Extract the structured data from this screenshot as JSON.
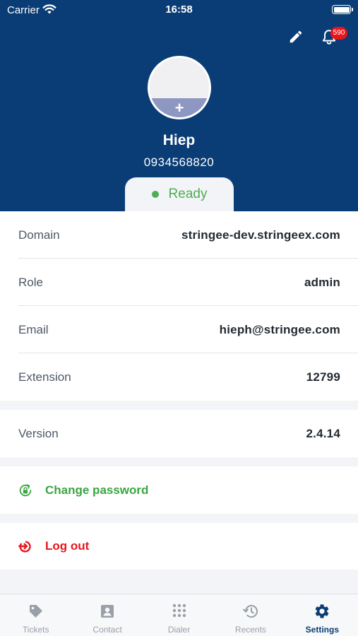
{
  "status_bar": {
    "carrier": "Carrier",
    "time": "16:58"
  },
  "header": {
    "notification_count": "590",
    "name": "Hiep",
    "phone": "0934568820",
    "status": "Ready",
    "status_color": "#4caf50",
    "header_color": "#0a3d75"
  },
  "info": {
    "domain": {
      "label": "Domain",
      "value": "stringee-dev.stringeex.com"
    },
    "role": {
      "label": "Role",
      "value": "admin"
    },
    "email": {
      "label": "Email",
      "value": "hieph@stringee.com"
    },
    "extension": {
      "label": "Extension",
      "value": "12799"
    },
    "version": {
      "label": "Version",
      "value": "2.4.14"
    }
  },
  "actions": {
    "change_password": {
      "label": "Change password",
      "icon": "lock-refresh-icon",
      "color": "#3aa642"
    },
    "logout": {
      "label": "Log out",
      "icon": "logout-icon",
      "color": "#e8151b"
    }
  },
  "tabs": [
    {
      "label": "Tickets",
      "icon": "tag-icon"
    },
    {
      "label": "Contact",
      "icon": "contact-card-icon"
    },
    {
      "label": "Dialer",
      "icon": "dialpad-icon"
    },
    {
      "label": "Recents",
      "icon": "history-icon"
    },
    {
      "label": "Settings",
      "icon": "gear-icon",
      "active": true
    }
  ]
}
